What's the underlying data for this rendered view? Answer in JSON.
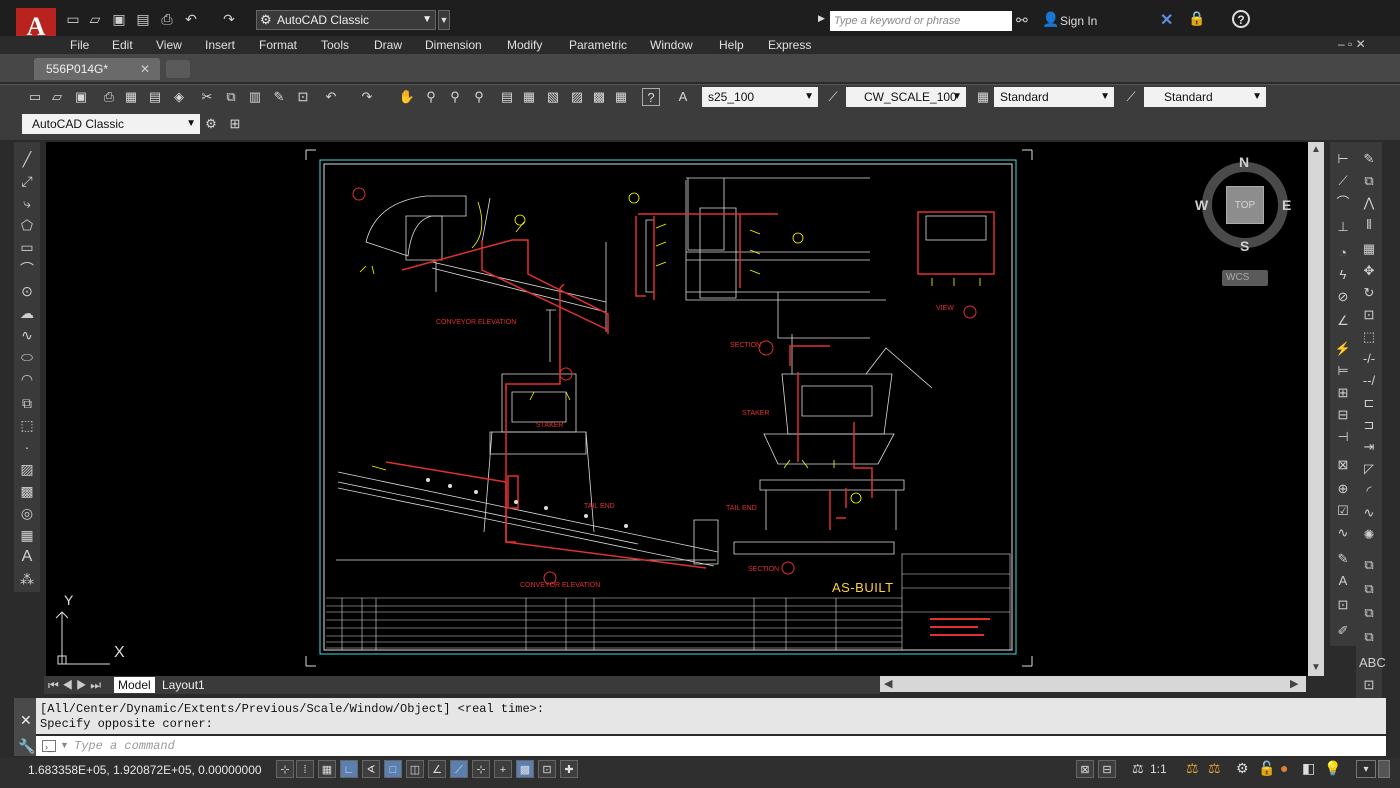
{
  "app": {
    "logo_text": "A"
  },
  "quick_access": {
    "workspace": "AutoCAD Classic"
  },
  "search": {
    "placeholder": "Type a keyword or phrase"
  },
  "account": {
    "sign_in": "Sign In"
  },
  "menu": [
    "File",
    "Edit",
    "View",
    "Insert",
    "Format",
    "Tools",
    "Draw",
    "Dimension",
    "Modify",
    "Parametric",
    "Window",
    "Help",
    "Express"
  ],
  "file_tab": {
    "name": "556P014G*"
  },
  "toolbar": {
    "text_style": "s25_100",
    "dim_style": "CW_SCALE_100",
    "table_style": "Standard",
    "multileader_style": "Standard"
  },
  "workspace_toolbar": {
    "workspace": "AutoCAD Classic"
  },
  "viewcube": {
    "north": "N",
    "south": "S",
    "east": "E",
    "west": "W",
    "face": "TOP",
    "ucs_menu": "WCS"
  },
  "ucs": {
    "y": "Y",
    "x": "X"
  },
  "layout_tabs": [
    "Model",
    "Layout1"
  ],
  "drawing": {
    "stamp": "AS-BUILT",
    "labels": [
      "CONVEYOR ELEVATION",
      "SECTION",
      "STAKER",
      "TAIL END",
      "VIEW",
      "CONVEYOR ELEVATION",
      "SECTION",
      "TAIL END",
      "STAKER"
    ]
  },
  "command": {
    "history": [
      "[All/Center/Dynamic/Extents/Previous/Scale/Window/Object] <real time>:",
      "Specify opposite corner:"
    ],
    "placeholder": "Type a command"
  },
  "status": {
    "coordinates": "1.683358E+05, 1.920872E+05, 0.00000000",
    "annotation_scale": "1:1"
  }
}
